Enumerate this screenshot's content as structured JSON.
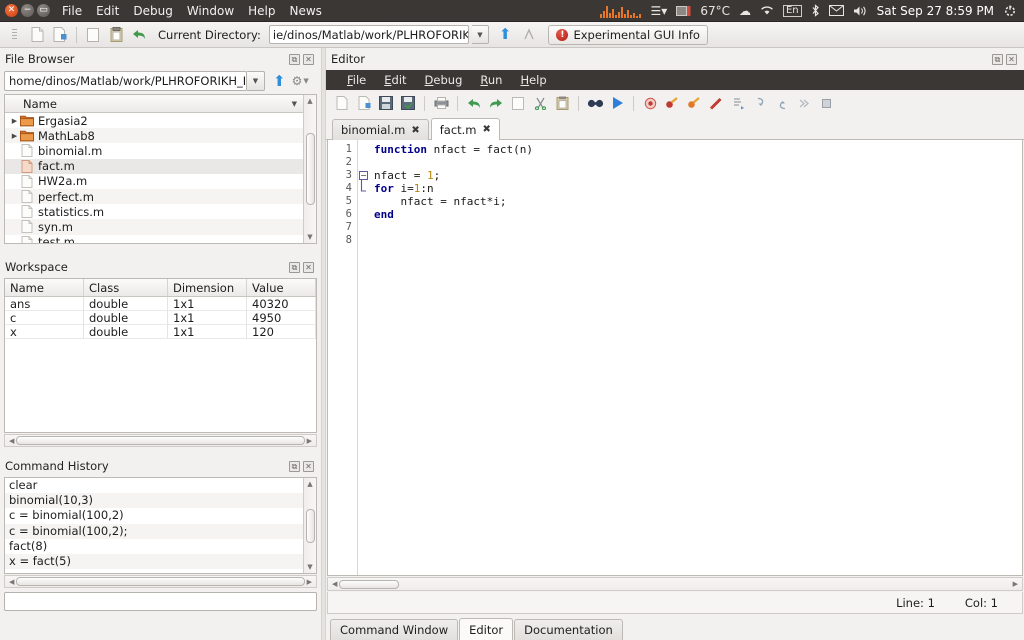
{
  "topbar": {
    "window_controls": [
      "close",
      "minimize",
      "maximize"
    ],
    "menus": [
      "File",
      "Edit",
      "Debug",
      "Window",
      "Help",
      "News"
    ],
    "tray": {
      "temperature": "67°C",
      "keyboard_layout": "En",
      "clock": "Sat Sep 27  8:59 PM",
      "icons": [
        "cpu-graph-icon",
        "hamburger-menu-icon",
        "battery-icon",
        "weather-cloud-icon",
        "wifi-icon",
        "keyboard-layout-icon",
        "bluetooth-icon",
        "mail-icon",
        "volume-icon",
        "power-gear-icon"
      ]
    }
  },
  "apptoolbar": {
    "current_directory_label": "Current Directory:",
    "current_directory_value": "ie/dinos/Matlab/work/PLHROFORIKH_I",
    "gui_info_button": "Experimental GUI Info",
    "icons": [
      "new-file-icon",
      "new-function-icon",
      "open-file-icon",
      "copy-icon",
      "paste-icon",
      "undo-icon"
    ]
  },
  "file_browser": {
    "title": "File Browser",
    "path": "home/dinos/Matlab/work/PLHROFORIKH_I",
    "column_header": "Name",
    "items": [
      {
        "name": "Ergasia2",
        "type": "folder",
        "expandable": true,
        "selected": false
      },
      {
        "name": "MathLab8",
        "type": "folder",
        "expandable": true,
        "selected": false
      },
      {
        "name": "binomial.m",
        "type": "file",
        "expandable": false,
        "selected": false
      },
      {
        "name": "fact.m",
        "type": "file",
        "expandable": false,
        "selected": true
      },
      {
        "name": "HW2a.m",
        "type": "file",
        "expandable": false,
        "selected": false
      },
      {
        "name": "perfect.m",
        "type": "file",
        "expandable": false,
        "selected": false
      },
      {
        "name": "statistics.m",
        "type": "file",
        "expandable": false,
        "selected": false
      },
      {
        "name": "syn.m",
        "type": "file",
        "expandable": false,
        "selected": false
      },
      {
        "name": "test.m",
        "type": "file",
        "expandable": false,
        "selected": false
      }
    ]
  },
  "workspace": {
    "title": "Workspace",
    "columns": [
      "Name",
      "Class",
      "Dimension",
      "Value"
    ],
    "rows": [
      [
        "ans",
        "double",
        "1x1",
        "40320"
      ],
      [
        "c",
        "double",
        "1x1",
        "4950"
      ],
      [
        "x",
        "double",
        "1x1",
        "120"
      ]
    ]
  },
  "command_history": {
    "title": "Command History",
    "entries": [
      "clear",
      "binomial(10,3)",
      "c = binomial(100,2)",
      "c = binomial(100,2);",
      "fact(8)",
      "x = fact(5)"
    ]
  },
  "bottom_input": {
    "value": "",
    "placeholder": ""
  },
  "editor": {
    "title": "Editor",
    "menus": [
      "File",
      "Edit",
      "Debug",
      "Run",
      "Help"
    ],
    "toolbar_icons": [
      "new-file-icon",
      "new-function-icon",
      "save-file-icon",
      "save-as-icon",
      "print-icon",
      "undo-icon",
      "redo-icon",
      "copy-icon",
      "cut-icon",
      "paste-icon",
      "find-replace-icon",
      "run-icon",
      "toggle-breakpoint-icon",
      "next-breakpoint-icon",
      "previous-breakpoint-icon",
      "remove-all-breakpoints-icon",
      "step-icon",
      "step-in-icon",
      "step-out-icon",
      "continue-icon",
      "stop-icon"
    ],
    "tabs": [
      {
        "label": "binomial.m",
        "active": false
      },
      {
        "label": "fact.m",
        "active": true
      }
    ],
    "line_numbers": [
      "1",
      "2",
      "3",
      "4",
      "5",
      "6",
      "7",
      "8"
    ],
    "code_lines": [
      [
        {
          "t": "function",
          "c": "kw"
        },
        {
          "t": " nfact = fact(n)",
          "c": "pl"
        }
      ],
      [],
      [
        {
          "t": "nfact = ",
          "c": "pl"
        },
        {
          "t": "1",
          "c": "num"
        },
        {
          "t": ";",
          "c": "pl"
        }
      ],
      [
        {
          "t": "for",
          "c": "kw"
        },
        {
          "t": " i=",
          "c": "pl"
        },
        {
          "t": "1",
          "c": "num"
        },
        {
          "t": ":n",
          "c": "pl"
        }
      ],
      [
        {
          "t": "    nfact = nfact*i;",
          "c": "pl"
        }
      ],
      [
        {
          "t": "end",
          "c": "kw"
        }
      ],
      [],
      []
    ],
    "fold_marker": "−",
    "status": {
      "line_label": "Line: 1",
      "col_label": "Col: 1"
    }
  },
  "bottom_tabs": [
    {
      "label": "Command Window",
      "active": false
    },
    {
      "label": "Editor",
      "active": true
    },
    {
      "label": "Documentation",
      "active": false
    }
  ],
  "colors": {
    "topbar_bg": "#3b3735",
    "panel_bg": "#f2f1f0",
    "accent_blue": "#2f8fd8",
    "keyword": "#00008b",
    "number": "#b8860b",
    "error_red": "#b41d14"
  }
}
